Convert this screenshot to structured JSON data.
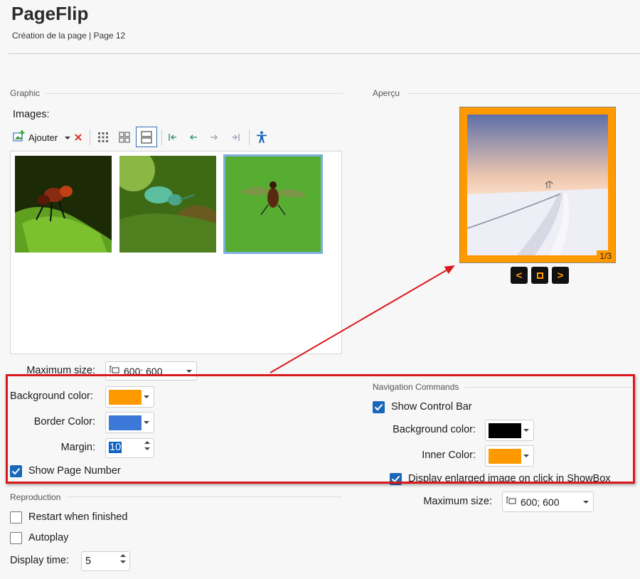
{
  "header": {
    "title": "PageFlip",
    "subtitle": "Création de la page | Page 12"
  },
  "graphic": {
    "section_label": "Graphic",
    "images_label": "Images:",
    "toolbar": {
      "add_label": "Ajouter"
    },
    "max_size_label": "Maximum size:",
    "max_size_value": "600; 600",
    "background_color_label": "Background color:",
    "background_color": "#ff9900",
    "border_color_label": "Border Color:",
    "border_color": "#3b78d8",
    "margin_label": "Margin:",
    "margin_value": "10",
    "show_page_number_label": "Show Page Number",
    "show_page_number": true
  },
  "preview": {
    "section_label": "Aperçu",
    "page_counter": "1/3",
    "nav_prev": "<",
    "nav_next": ">"
  },
  "navigation": {
    "section_label": "Navigation Commands",
    "show_control_bar_label": "Show Control Bar",
    "show_control_bar": true,
    "background_color_label": "Background color:",
    "background_color": "#000000",
    "inner_color_label": "Inner Color:",
    "inner_color": "#ff9900",
    "enlarged_label": "Display enlarged image on click in ShowBox",
    "enlarged": true,
    "max_size_label": "Maximum size:",
    "max_size_value": "600; 600"
  },
  "reproduction": {
    "section_label": "Reproduction",
    "restart_label": "Restart when finished",
    "restart": false,
    "autoplay_label": "Autoplay",
    "autoplay": false,
    "display_time_label": "Display time:",
    "display_time_value": "5"
  }
}
